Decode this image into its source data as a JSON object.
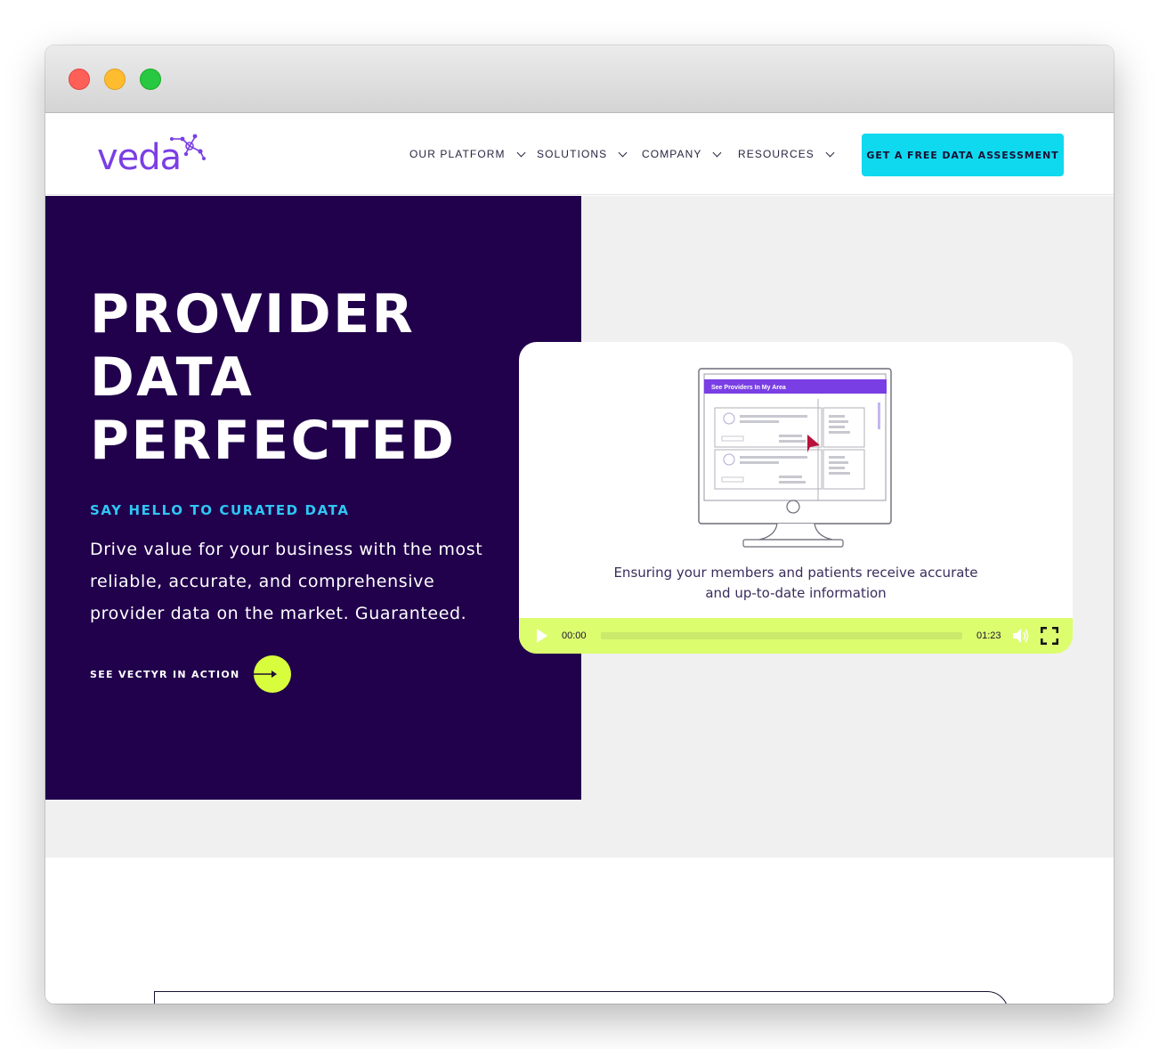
{
  "header": {
    "logo_text": "veda",
    "nav": [
      {
        "label": "OUR PLATFORM"
      },
      {
        "label": "SOLUTIONS"
      },
      {
        "label": "COMPANY"
      },
      {
        "label": "RESOURCES"
      }
    ],
    "cta_label": "GET A FREE DATA ASSESSMENT"
  },
  "hero": {
    "headline": [
      "PROVIDER",
      "DATA",
      "PERFECTED"
    ],
    "eyebrow": "SAY HELLO TO CURATED DATA",
    "lead": "Drive value for your business with the most reliable, accurate, and comprehensive provider data on the market. Guaranteed.",
    "action_label": "SEE VECTYR IN ACTION"
  },
  "video": {
    "screen_title": "See Providers In My Area",
    "caption": [
      "Ensuring your members and patients receive accurate",
      "and up-to-date information"
    ],
    "current_time": "00:00",
    "duration": "01:23",
    "progress": 0
  },
  "colors": {
    "brand_purple": "#7a3fe4",
    "hero_navy": "#21004c",
    "cta_cyan": "#0fd9ef",
    "accent_lime": "#d8fd3c",
    "eyebrow_blue": "#2fc6f4"
  }
}
